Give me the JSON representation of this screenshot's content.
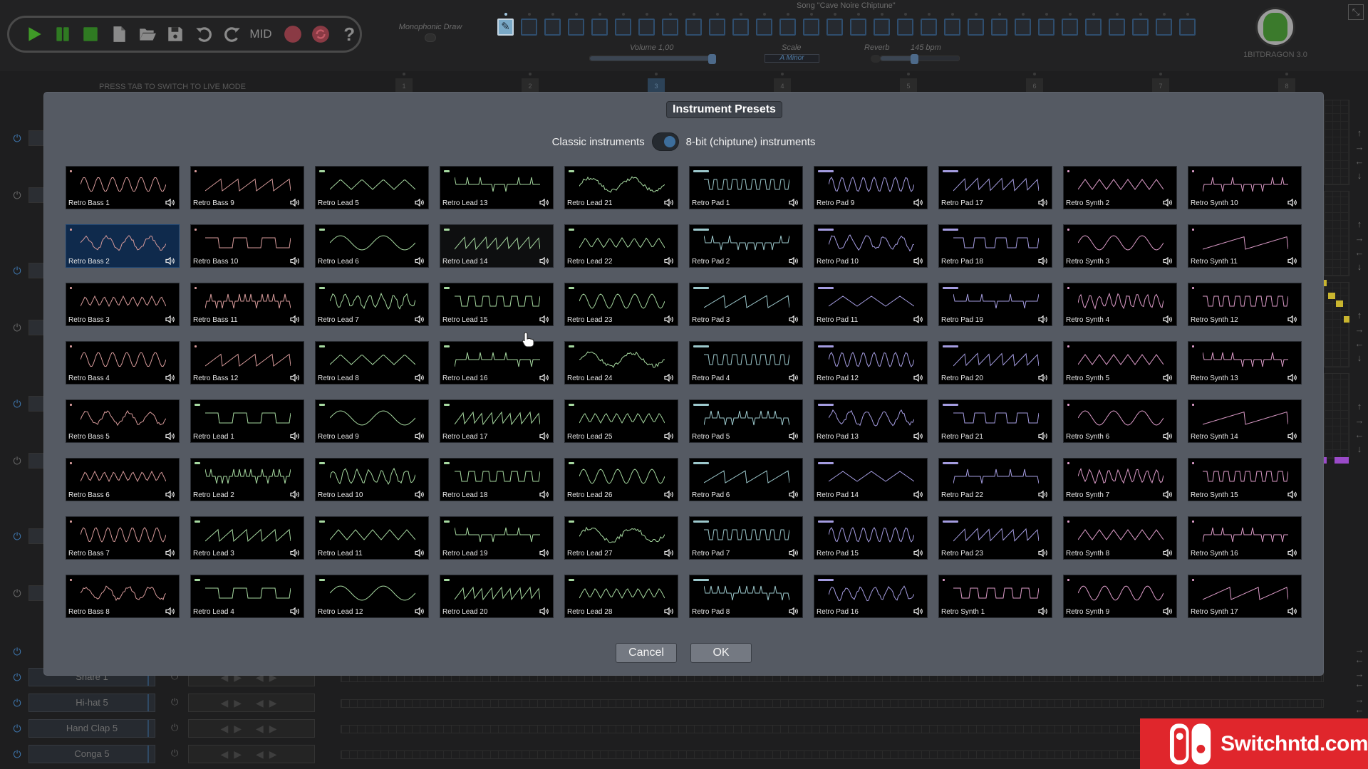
{
  "toolbar": {
    "buttons": [
      {
        "id": "play",
        "icon": "play-icon",
        "color": "#3f9a27"
      },
      {
        "id": "pause",
        "icon": "pause-icon",
        "color": "#2f7a22"
      },
      {
        "id": "stop",
        "icon": "stop-icon",
        "color": "#2f7a22"
      },
      {
        "id": "new",
        "icon": "new-file-icon",
        "color": "#8a8a8a"
      },
      {
        "id": "open",
        "icon": "open-folder-icon",
        "color": "#8a8a8a"
      },
      {
        "id": "save",
        "icon": "save-icon",
        "color": "#8a8a8a"
      },
      {
        "id": "undo",
        "icon": "undo-icon",
        "color": "#8a8a8a"
      },
      {
        "id": "redo",
        "icon": "redo-icon",
        "color": "#8a8a8a"
      }
    ],
    "mid_label": "MID",
    "record_color": "#8a3a44",
    "help_glyph": "?"
  },
  "header": {
    "monophonic_draw_label": "Monophonic Draw",
    "song_title": "Song \"Cave Noire Chiptune\"",
    "pattern_slots": 30,
    "active_pattern_slot": 1,
    "volume_label": "Volume 1,00",
    "volume_value": 1.0,
    "scale_label": "Scale",
    "scale_value": "A Minor",
    "reverb_label": "Reverb",
    "tempo_label": "145 bpm",
    "tempo_fraction": 0.42,
    "brand": "1BITDRAGON 3.0",
    "fullscreen_glyph": "⤡"
  },
  "live_hint": "PRESS TAB TO SWITCH TO LIVE MODE",
  "bar_markers": [
    "1",
    "2",
    "3",
    "4",
    "5",
    "6",
    "7",
    "8"
  ],
  "active_bar": "3",
  "tracks": [
    {
      "name": "Snare 1"
    },
    {
      "name": "Hi-hat 5"
    },
    {
      "name": "Hand Clap 5"
    },
    {
      "name": "Conga 5"
    }
  ],
  "dialog": {
    "title": "Instrument Presets",
    "mode_left": "Classic instruments",
    "mode_right": "8-bit (chiptune) instruments",
    "mode_selected": "8-bit (chiptune) instruments",
    "cancel_label": "Cancel",
    "ok_label": "OK",
    "selected_preset": "Retro Bass 2",
    "hovered_preset": "Retro Lead 14",
    "category_colors": {
      "bass": "#d79a9a",
      "lead": "#a6d9a0",
      "pad_cyan": "#9cc8cc",
      "pad_violet": "#a49ce0",
      "synth": "#dc9bc8"
    },
    "rows": [
      [
        "Retro Bass 1",
        "Retro Bass 9",
        "Retro Lead 5",
        "Retro Lead 13",
        "Retro Lead 21",
        "Retro Pad 1",
        "Retro Pad 9",
        "Retro Pad 17",
        "Retro Synth 2",
        "Retro Synth 10"
      ],
      [
        "Retro Bass 2",
        "Retro Bass 10",
        "Retro Lead 6",
        "Retro Lead 14",
        "Retro Lead 22",
        "Retro Pad 2",
        "Retro Pad 10",
        "Retro Pad 18",
        "Retro Synth 3",
        "Retro Synth 11"
      ],
      [
        "Retro Bass 3",
        "Retro Bass 11",
        "Retro Lead 7",
        "Retro Lead 15",
        "Retro Lead 23",
        "Retro Pad 3",
        "Retro Pad 11",
        "Retro Pad 19",
        "Retro Synth 4",
        "Retro Synth 12"
      ],
      [
        "Retro Bass 4",
        "Retro Bass 12",
        "Retro Lead 8",
        "Retro Lead 16",
        "Retro Lead 24",
        "Retro Pad 4",
        "Retro Pad 12",
        "Retro Pad 20",
        "Retro Synth 5",
        "Retro Synth 13"
      ],
      [
        "Retro Bass 5",
        "Retro Lead 1",
        "Retro Lead 9",
        "Retro Lead 17",
        "Retro Lead 25",
        "Retro Pad 5",
        "Retro Pad 13",
        "Retro Pad 21",
        "Retro Synth 6",
        "Retro Synth 14"
      ],
      [
        "Retro Bass 6",
        "Retro Lead 2",
        "Retro Lead 10",
        "Retro Lead 18",
        "Retro Lead 26",
        "Retro Pad 6",
        "Retro Pad 14",
        "Retro Pad 22",
        "Retro Synth 7",
        "Retro Synth 15"
      ],
      [
        "Retro Bass 7",
        "Retro Lead 3",
        "Retro Lead 11",
        "Retro Lead 19",
        "Retro Lead 27",
        "Retro Pad 7",
        "Retro Pad 15",
        "Retro Pad 23",
        "Retro Synth 8",
        "Retro Synth 16"
      ],
      [
        "Retro Bass 8",
        "Retro Lead 4",
        "Retro Lead 12",
        "Retro Lead 20",
        "Retro Lead 28",
        "Retro Pad 8",
        "Retro Pad 16",
        "Retro Synth 1",
        "Retro Synth 9",
        "Retro Synth 17"
      ]
    ]
  },
  "watermark": {
    "text": "Switchntd.com",
    "color": "#e0262c"
  }
}
